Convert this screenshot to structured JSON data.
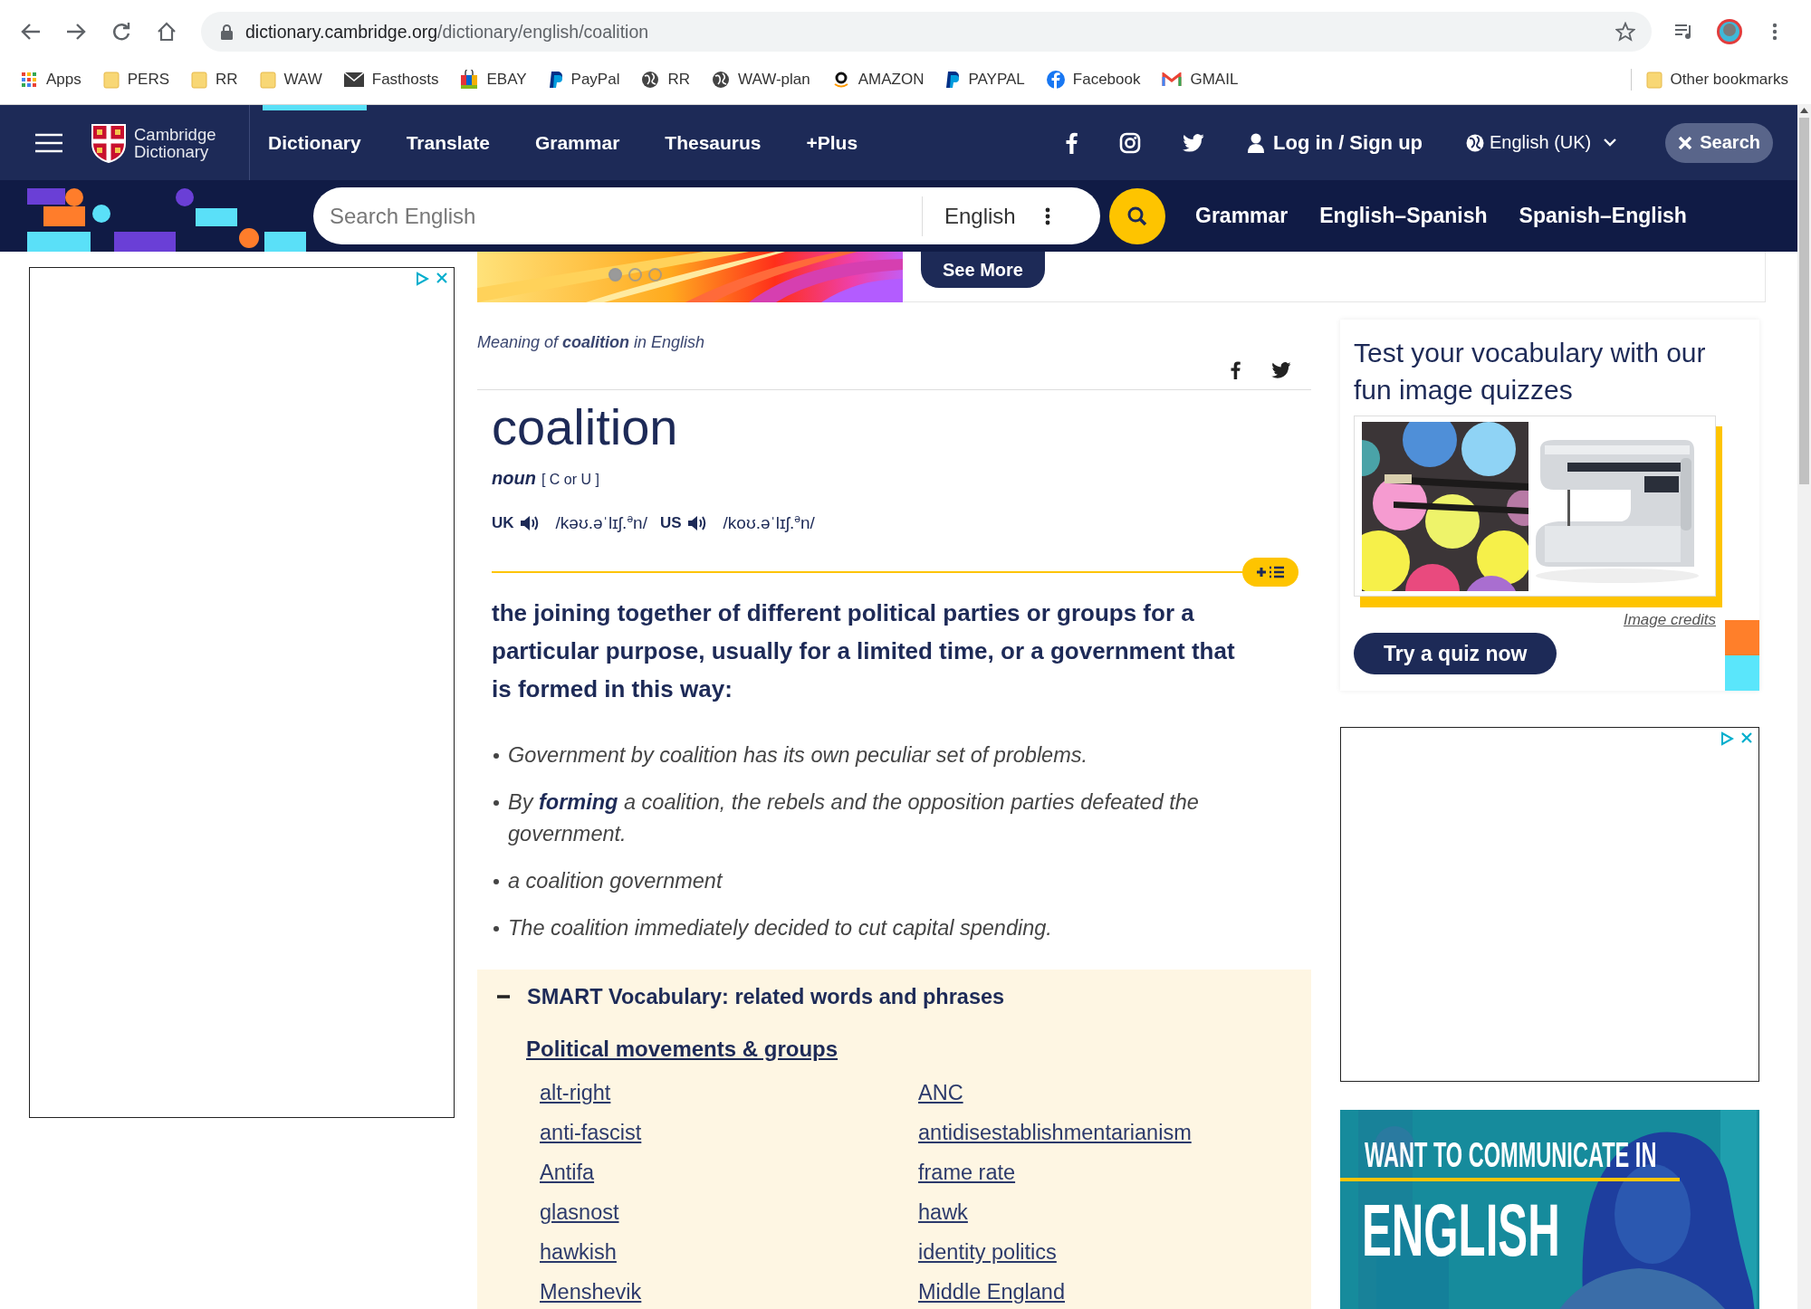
{
  "browser": {
    "url_host": "dictionary.cambridge.org",
    "url_path": "/dictionary/english/coalition",
    "bookmarks": [
      {
        "label": "Apps",
        "kind": "apps"
      },
      {
        "label": "PERS",
        "kind": "folder"
      },
      {
        "label": "RR",
        "kind": "folder"
      },
      {
        "label": "WAW",
        "kind": "folder"
      },
      {
        "label": "Fasthosts",
        "kind": "mail"
      },
      {
        "label": "EBAY",
        "kind": "bag"
      },
      {
        "label": "PayPal",
        "kind": "paypal"
      },
      {
        "label": "RR",
        "kind": "globe"
      },
      {
        "label": "WAW-plan",
        "kind": "globe"
      },
      {
        "label": "AMAZON",
        "kind": "amazon"
      },
      {
        "label": "PAYPAL",
        "kind": "paypal"
      },
      {
        "label": "Facebook",
        "kind": "facebook"
      },
      {
        "label": "GMAIL",
        "kind": "gmail"
      }
    ],
    "other_bookmarks": "Other bookmarks"
  },
  "nav": {
    "logo": "Cambridge Dictionary",
    "tabs": [
      {
        "label": "Dictionary",
        "selected": true
      },
      {
        "label": "Translate",
        "selected": false
      },
      {
        "label": "Grammar",
        "selected": false
      },
      {
        "label": "Thesaurus",
        "selected": false
      },
      {
        "label": "+Plus",
        "selected": false
      }
    ],
    "login": "Log in / Sign up",
    "language": "English (UK)",
    "search_button": "Search"
  },
  "search": {
    "placeholder": "Search English",
    "dictionary": "English",
    "links": [
      "Grammar",
      "English–Spanish",
      "Spanish–English"
    ]
  },
  "banner": {
    "button": "See More",
    "carousel": [
      {
        "selected": true
      },
      {
        "selected": false
      },
      {
        "selected": false
      }
    ]
  },
  "entry": {
    "meaning_label": "Meaning of **coalition** in English",
    "headword": "coalition",
    "pos": "noun",
    "grammar": "[ C or U ]",
    "pronunciations": [
      {
        "region": "UK",
        "ipa": "/kəʊ.əˈlɪʃ.$^{ə}$n/"
      },
      {
        "region": "US",
        "ipa": "/koʊ.əˈlɪʃ.$^{ə}$n/"
      }
    ],
    "definition": "the joining together of different political parties or groups for a particular purpose, usually for a limited time, or a government that is formed in this way:",
    "examples": [
      "Government by coalition has its own peculiar set of problems.",
      "By **forming** a coalition, the rebels and the opposition parties defeated the government.",
      "a coalition government",
      "The coalition immediately decided to cut capital spending."
    ]
  },
  "smart_vocabulary": {
    "title": "SMART Vocabulary: related words and phrases",
    "expanded": true,
    "topic": "Political movements & groups",
    "words": [
      "alt-right",
      "ANC",
      "anti-fascist",
      "antidisestablishmentarianism",
      "Antifa",
      "frame rate",
      "glasnost",
      "hawk",
      "hawkish",
      "identity politics",
      "Menshevik",
      "Middle England"
    ]
  },
  "quiz": {
    "title": "Test your vocabulary with our fun image quizzes",
    "credits": "Image credits",
    "button": "Try a quiz now"
  },
  "ad": {
    "headline": "WANT TO COMMUNICATE IN",
    "title": "ENGLISH"
  }
}
